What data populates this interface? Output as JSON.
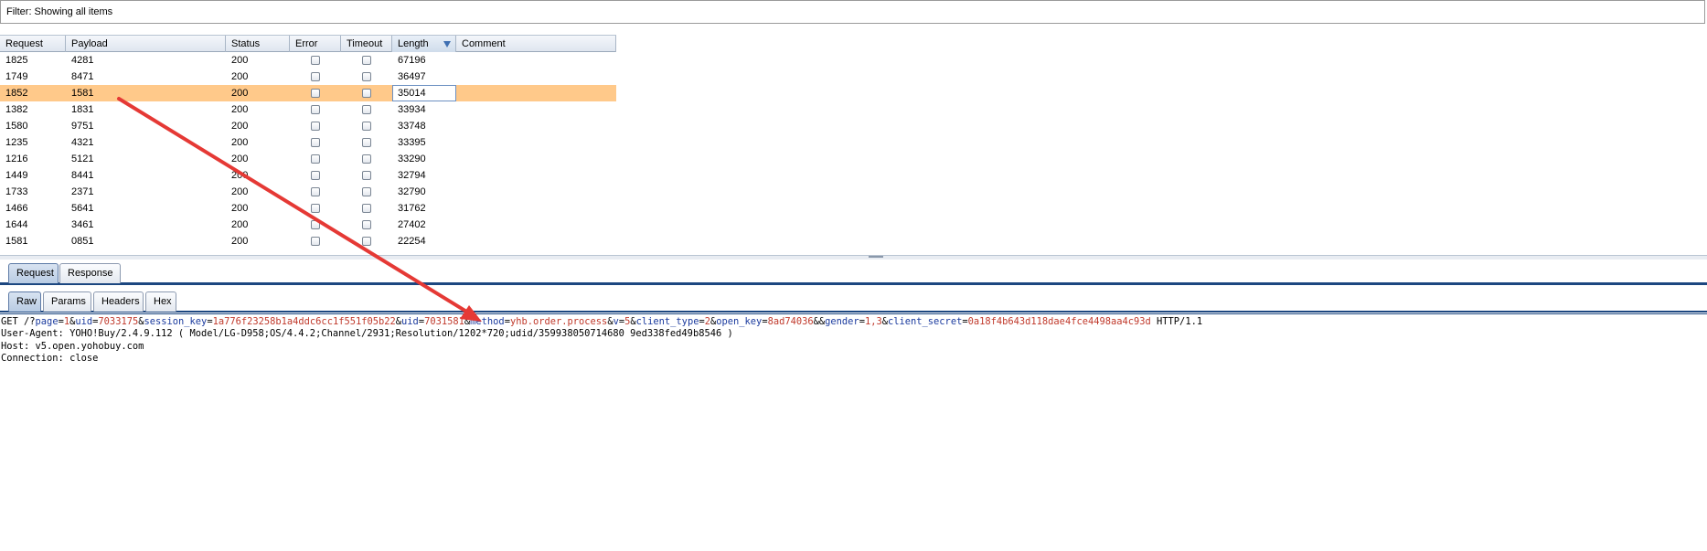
{
  "filter": {
    "text": "Filter: Showing all items"
  },
  "table": {
    "columns": [
      "Request",
      "Payload",
      "Status",
      "Error",
      "Timeout",
      "Length",
      "Comment"
    ],
    "rows": [
      [
        "1825",
        "4281",
        "200",
        "",
        "",
        "67196",
        ""
      ],
      [
        "1749",
        "8471",
        "200",
        "",
        "",
        "36497",
        ""
      ],
      [
        "1852",
        "1581",
        "200",
        "",
        "",
        "35014",
        ""
      ],
      [
        "1382",
        "1831",
        "200",
        "",
        "",
        "33934",
        ""
      ],
      [
        "1580",
        "9751",
        "200",
        "",
        "",
        "33748",
        ""
      ],
      [
        "1235",
        "4321",
        "200",
        "",
        "",
        "33395",
        ""
      ],
      [
        "1216",
        "5121",
        "200",
        "",
        "",
        "33290",
        ""
      ],
      [
        "1449",
        "8441",
        "200",
        "",
        "",
        "32794",
        ""
      ],
      [
        "1733",
        "2371",
        "200",
        "",
        "",
        "32790",
        ""
      ],
      [
        "1466",
        "5641",
        "200",
        "",
        "",
        "31762",
        ""
      ],
      [
        "1644",
        "3461",
        "200",
        "",
        "",
        "27402",
        ""
      ],
      [
        "1581",
        "0851",
        "200",
        "",
        "",
        "22254",
        ""
      ]
    ],
    "selected_row_index": 2,
    "sorted_column": "Length"
  },
  "tabs_top": {
    "request": "Request",
    "response": "Response"
  },
  "tabs_sub": {
    "raw": "Raw",
    "params": "Params",
    "headers": "Headers",
    "hex": "Hex"
  },
  "raw_request": {
    "line1": [
      {
        "t": "GET /?",
        "c": "p"
      },
      {
        "t": "page",
        "c": "k"
      },
      {
        "t": "=",
        "c": "p"
      },
      {
        "t": "1",
        "c": "v"
      },
      {
        "t": "&",
        "c": "p"
      },
      {
        "t": "uid",
        "c": "k"
      },
      {
        "t": "=",
        "c": "p"
      },
      {
        "t": "7033175",
        "c": "v"
      },
      {
        "t": "&",
        "c": "p"
      },
      {
        "t": "session_key",
        "c": "k"
      },
      {
        "t": "=",
        "c": "p"
      },
      {
        "t": "1a776f23258b1a4ddc6cc1f551f05b22",
        "c": "v"
      },
      {
        "t": "&",
        "c": "p"
      },
      {
        "t": "uid",
        "c": "k"
      },
      {
        "t": "=",
        "c": "p"
      },
      {
        "t": "7031581",
        "c": "v"
      },
      {
        "t": "&",
        "c": "p"
      },
      {
        "t": "method",
        "c": "k"
      },
      {
        "t": "=",
        "c": "p"
      },
      {
        "t": "yhb.order.process",
        "c": "v"
      },
      {
        "t": "&",
        "c": "p"
      },
      {
        "t": "v",
        "c": "k"
      },
      {
        "t": "=",
        "c": "p"
      },
      {
        "t": "5",
        "c": "v"
      },
      {
        "t": "&",
        "c": "p"
      },
      {
        "t": "client_type",
        "c": "k"
      },
      {
        "t": "=",
        "c": "p"
      },
      {
        "t": "2",
        "c": "v"
      },
      {
        "t": "&",
        "c": "p"
      },
      {
        "t": "open_key",
        "c": "k"
      },
      {
        "t": "=",
        "c": "p"
      },
      {
        "t": "8ad74036",
        "c": "v"
      },
      {
        "t": "&&",
        "c": "p"
      },
      {
        "t": "gender",
        "c": "k"
      },
      {
        "t": "=",
        "c": "p"
      },
      {
        "t": "1,3",
        "c": "v"
      },
      {
        "t": "&",
        "c": "p"
      },
      {
        "t": "client_secret",
        "c": "k"
      },
      {
        "t": "=",
        "c": "p"
      },
      {
        "t": "0a18f4b643d118dae4fce4498aa4c93d",
        "c": "v"
      },
      {
        "t": " HTTP/1.1",
        "c": "p"
      }
    ],
    "line2": "User-Agent: YOHO!Buy/2.4.9.112 ( Model/LG-D958;OS/4.4.2;Channel/2931;Resolution/1202*720;udid/359938050714680 9ed338fed49b8546 )",
    "line3": "Host: v5.open.yohobuy.com",
    "line4": "Connection: close"
  },
  "colors": {
    "selected_row": "#ffc98a",
    "annotation_arrow": "#e53935",
    "param_key": "#1a3a9e",
    "param_value": "#c0392b"
  }
}
